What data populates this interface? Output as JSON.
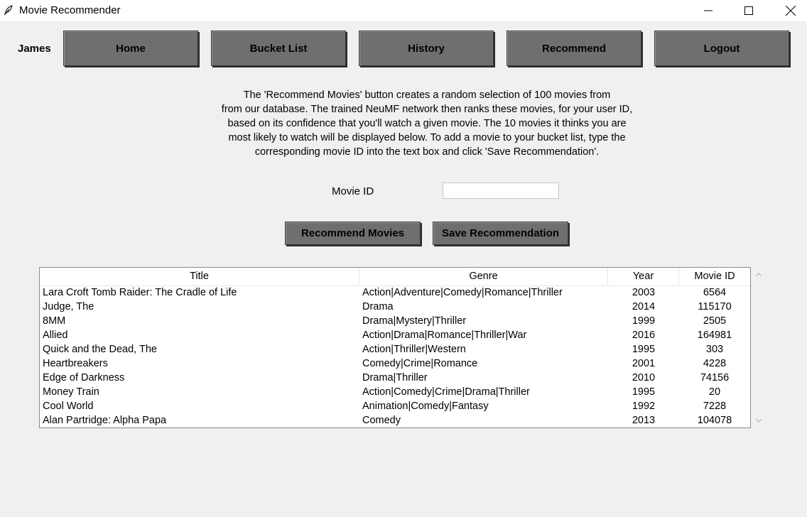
{
  "window": {
    "title": "Movie Recommender",
    "icon": "feather-app-icon",
    "controls": [
      "minimize-icon",
      "maximize-icon",
      "close-icon"
    ]
  },
  "nav": {
    "user": "James",
    "home": "Home",
    "bucket_list": "Bucket List",
    "history": "History",
    "recommend": "Recommend",
    "logout": "Logout"
  },
  "description": {
    "line1": "The 'Recommend Movies' button creates a random selection of 100 movies from",
    "line2": "from our database. The trained NeuMF network then ranks these movies, for your user ID,",
    "line3": "based on its confidence that you'll watch a given movie. The 10 movies it thinks you are",
    "line4": "most likely to watch will be displayed below. To add a movie to your bucket list, type the",
    "line5": "corresponding movie ID into the text box and click 'Save Recommendation'."
  },
  "form": {
    "movie_id_label": "Movie ID",
    "movie_id_value": "",
    "recommend_button": "Recommend Movies",
    "save_button": "Save Recommendation"
  },
  "table": {
    "headers": {
      "title": "Title",
      "genre": "Genre",
      "year": "Year",
      "movie_id": "Movie ID"
    },
    "rows": [
      {
        "title": "Lara Croft Tomb Raider: The Cradle of Life",
        "genre": "Action|Adventure|Comedy|Romance|Thriller",
        "year": "2003",
        "movie_id": "6564"
      },
      {
        "title": "Judge, The",
        "genre": "Drama",
        "year": "2014",
        "movie_id": "115170"
      },
      {
        "title": "8MM",
        "genre": "Drama|Mystery|Thriller",
        "year": "1999",
        "movie_id": "2505"
      },
      {
        "title": "Allied",
        "genre": "Action|Drama|Romance|Thriller|War",
        "year": "2016",
        "movie_id": "164981"
      },
      {
        "title": "Quick and the Dead, The",
        "genre": "Action|Thriller|Western",
        "year": "1995",
        "movie_id": "303"
      },
      {
        "title": "Heartbreakers",
        "genre": "Comedy|Crime|Romance",
        "year": "2001",
        "movie_id": "4228"
      },
      {
        "title": "Edge of Darkness",
        "genre": "Drama|Thriller",
        "year": "2010",
        "movie_id": "74156"
      },
      {
        "title": "Money Train",
        "genre": "Action|Comedy|Crime|Drama|Thriller",
        "year": "1995",
        "movie_id": "20"
      },
      {
        "title": "Cool World",
        "genre": "Animation|Comedy|Fantasy",
        "year": "1992",
        "movie_id": "7228"
      },
      {
        "title": "Alan Partridge: Alpha Papa",
        "genre": "Comedy",
        "year": "2013",
        "movie_id": "104078"
      }
    ]
  },
  "colors": {
    "background": "#f0f0f0",
    "button": "#6f6f6f",
    "table_bg": "#ffffff"
  }
}
